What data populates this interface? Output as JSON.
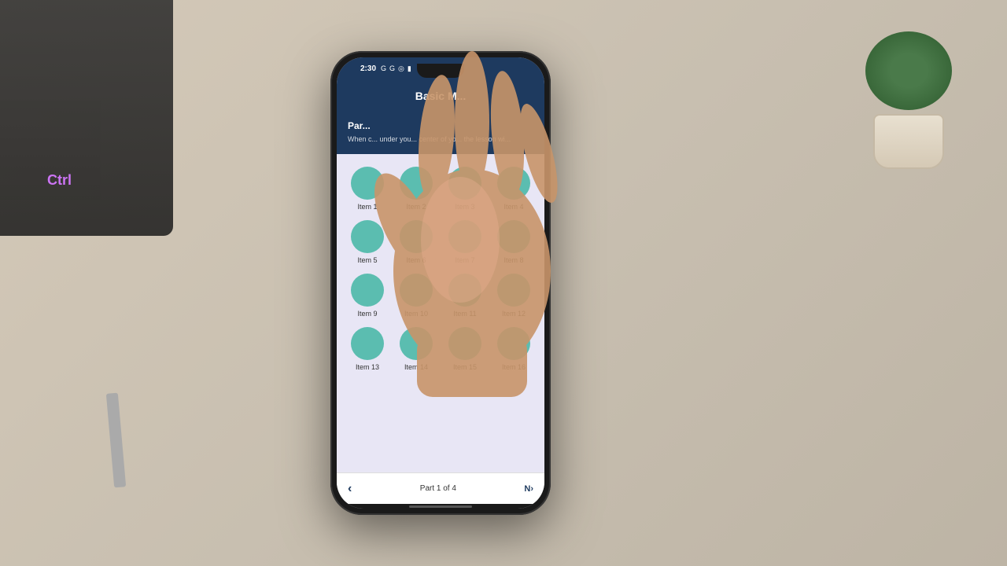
{
  "background": {
    "color": "#c8bfb0"
  },
  "phone": {
    "status_bar": {
      "time": "2:30",
      "icons": [
        "G",
        "G",
        "◎",
        "🔋"
      ]
    },
    "header": {
      "title": "Basic M..."
    },
    "instruction": {
      "title": "Par...",
      "text": "When c... under you... center of yo... the lesson wi..."
    },
    "grid": {
      "items": [
        {
          "id": 1,
          "label": "Item 1"
        },
        {
          "id": 2,
          "label": "Item 2"
        },
        {
          "id": 3,
          "label": "Item 3"
        },
        {
          "id": 4,
          "label": "Item 4"
        },
        {
          "id": 5,
          "label": "Item 5"
        },
        {
          "id": 6,
          "label": "Item 6"
        },
        {
          "id": 7,
          "label": "Item 7"
        },
        {
          "id": 8,
          "label": "Item 8"
        },
        {
          "id": 9,
          "label": "Item 9"
        },
        {
          "id": 10,
          "label": "Item 10"
        },
        {
          "id": 11,
          "label": "Item 11"
        },
        {
          "id": 12,
          "label": "Item 12"
        },
        {
          "id": 13,
          "label": "Item 13"
        },
        {
          "id": 14,
          "label": "Item 14"
        },
        {
          "id": 15,
          "label": "Item 15"
        },
        {
          "id": 16,
          "label": "Item 16"
        }
      ]
    },
    "navigation": {
      "back_label": "‹",
      "page_info": "Part 1 of 4",
      "next_label": "N›"
    }
  }
}
